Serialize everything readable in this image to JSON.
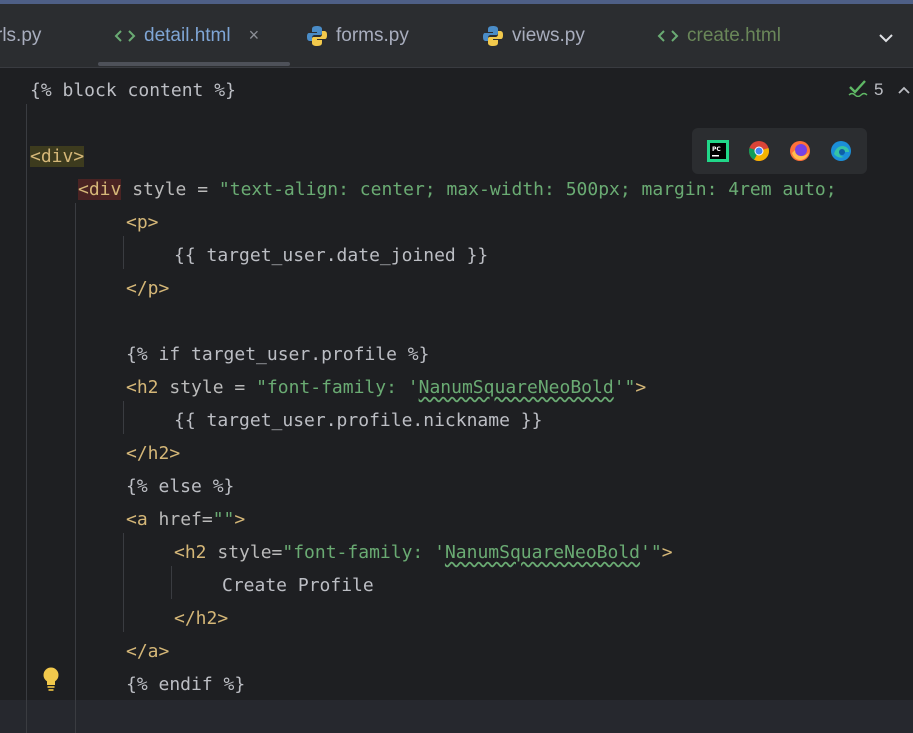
{
  "tabs": [
    {
      "label": "rls.py",
      "icon": "python-icon",
      "active": false
    },
    {
      "label": "detail.html",
      "icon": "html-icon",
      "active": true,
      "close": "×"
    },
    {
      "label": "forms.py",
      "icon": "python-icon",
      "active": false
    },
    {
      "label": "views.py",
      "icon": "python-icon",
      "active": false
    },
    {
      "label": "create.html",
      "icon": "html-icon",
      "active": false
    }
  ],
  "inspection": {
    "count": "5",
    "icon": "check-icon"
  },
  "browsers": [
    "pycharm-icon",
    "chrome-icon",
    "firefox-icon",
    "edge-icon"
  ],
  "code": {
    "l1": "{% block content %}",
    "l3_tag": "<div>",
    "l4_tag_open": "<div",
    "l4_attr": " style = ",
    "l4_str": "\"text-align: center; max-width: 500px; margin: 4rem auto;",
    "l5": "<p>",
    "l6": "{{ target_user.date_joined }}",
    "l7": "</p>",
    "l9": "{% if target_user.profile %}",
    "l10_tag": "<h2",
    "l10_attr": " style = ",
    "l10_str_a": "\"font-family: '",
    "l10_str_b": "NanumSquareNeoBold",
    "l10_str_c": "'\"",
    "l10_end": ">",
    "l11": "{{ target_user.profile.nickname }}",
    "l12": "</h2>",
    "l13": "{% else %}",
    "l14_tag": "<a",
    "l14_attr": " href=",
    "l14_str": "\"\"",
    "l14_end": ">",
    "l15_tag": "<h2",
    "l15_attr": " style=",
    "l15_str_a": "\"font-family: '",
    "l15_str_b": "NanumSquareNeoBold",
    "l15_str_c": "'\"",
    "l15_end": ">",
    "l16": "Create Profile",
    "l17": "</h2>",
    "l18": "</a>",
    "l19": "{% endif %}"
  }
}
